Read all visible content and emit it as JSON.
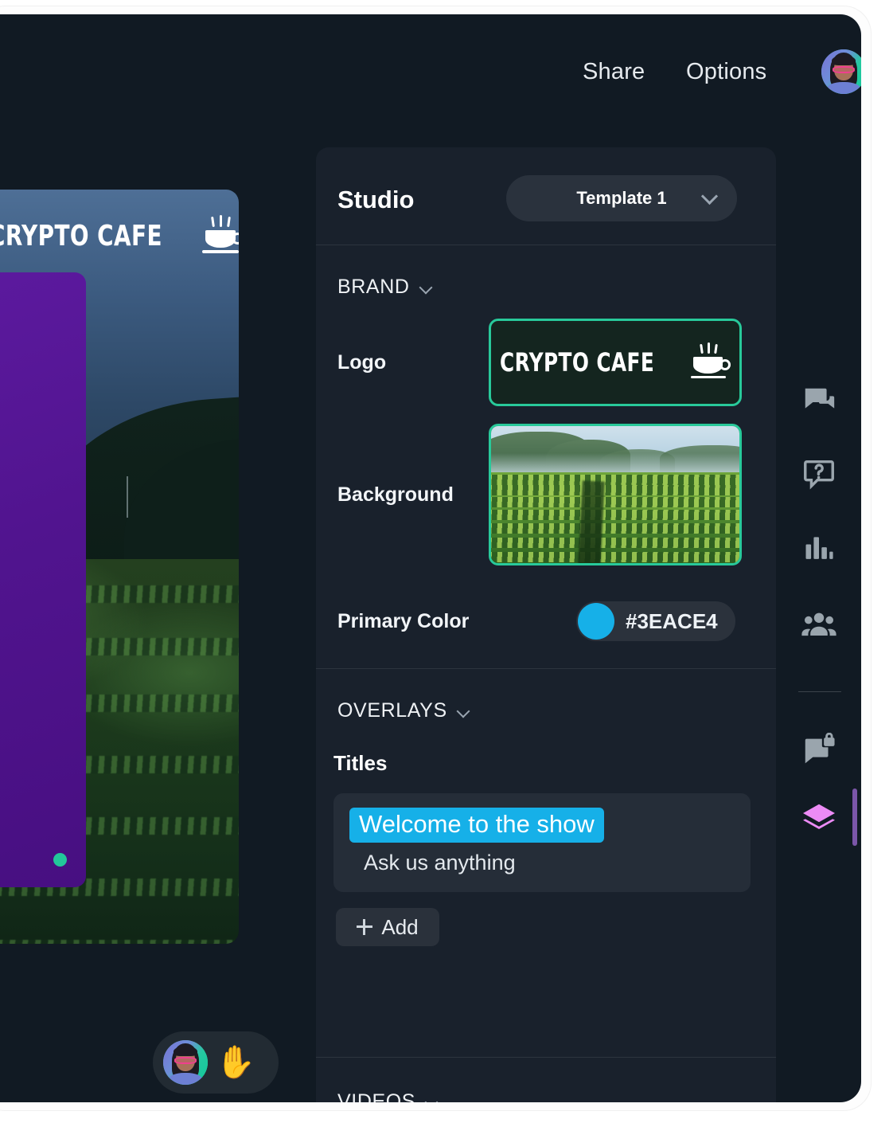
{
  "topbar": {
    "share_label": "Share",
    "options_label": "Options",
    "avatar_name": "user-avatar"
  },
  "stage": {
    "logo_text": "CRYPTO CAFE",
    "logo_icon": "coffee-cup-icon",
    "overlay_card_color": "#51148F",
    "status_dot_color": "#22C79A",
    "self_pill": {
      "hand_icon": "raised-hand-icon",
      "avatar_name": "self-avatar"
    }
  },
  "panel": {
    "title": "Studio",
    "template": {
      "value": "Template 1",
      "chevron_icon": "chevron-down-icon"
    },
    "brand": {
      "section_label": "BRAND",
      "chevron_icon": "chevron-down-icon",
      "logo": {
        "label": "Logo",
        "text": "CRYPTO CAFE",
        "icon": "coffee-cup-icon",
        "border_color": "#28C99A"
      },
      "background": {
        "label": "Background",
        "image_alt": "tea-plantation-photo",
        "border_color": "#28C99A"
      },
      "primary_color": {
        "label": "Primary Color",
        "hex": "#3EACE4",
        "swatch_color": "#16B0E8"
      }
    },
    "overlays": {
      "section_label": "OVERLAYS",
      "chevron_icon": "chevron-down-icon",
      "titles_label": "Titles",
      "title_primary": "Welcome to the show",
      "title_secondary": "Ask us anything",
      "title_highlight_color": "#16B0E8",
      "add_label": "Add",
      "add_icon": "plus-icon"
    },
    "videos": {
      "section_label": "VIDEOS",
      "chevron_icon": "chevron-down-icon"
    }
  },
  "rail": {
    "items": [
      {
        "name": "chat-icon",
        "title": "Chat"
      },
      {
        "name": "question-icon",
        "title": "Q&A"
      },
      {
        "name": "polls-icon",
        "title": "Polls"
      },
      {
        "name": "people-icon",
        "title": "People"
      },
      {
        "name": "private-chat-icon",
        "title": "Private chat"
      },
      {
        "name": "layers-icon",
        "title": "Studio"
      }
    ],
    "active_item": "layers-icon",
    "active_color": "#EC8BF5",
    "active_bar_color": "#7B56A8"
  }
}
